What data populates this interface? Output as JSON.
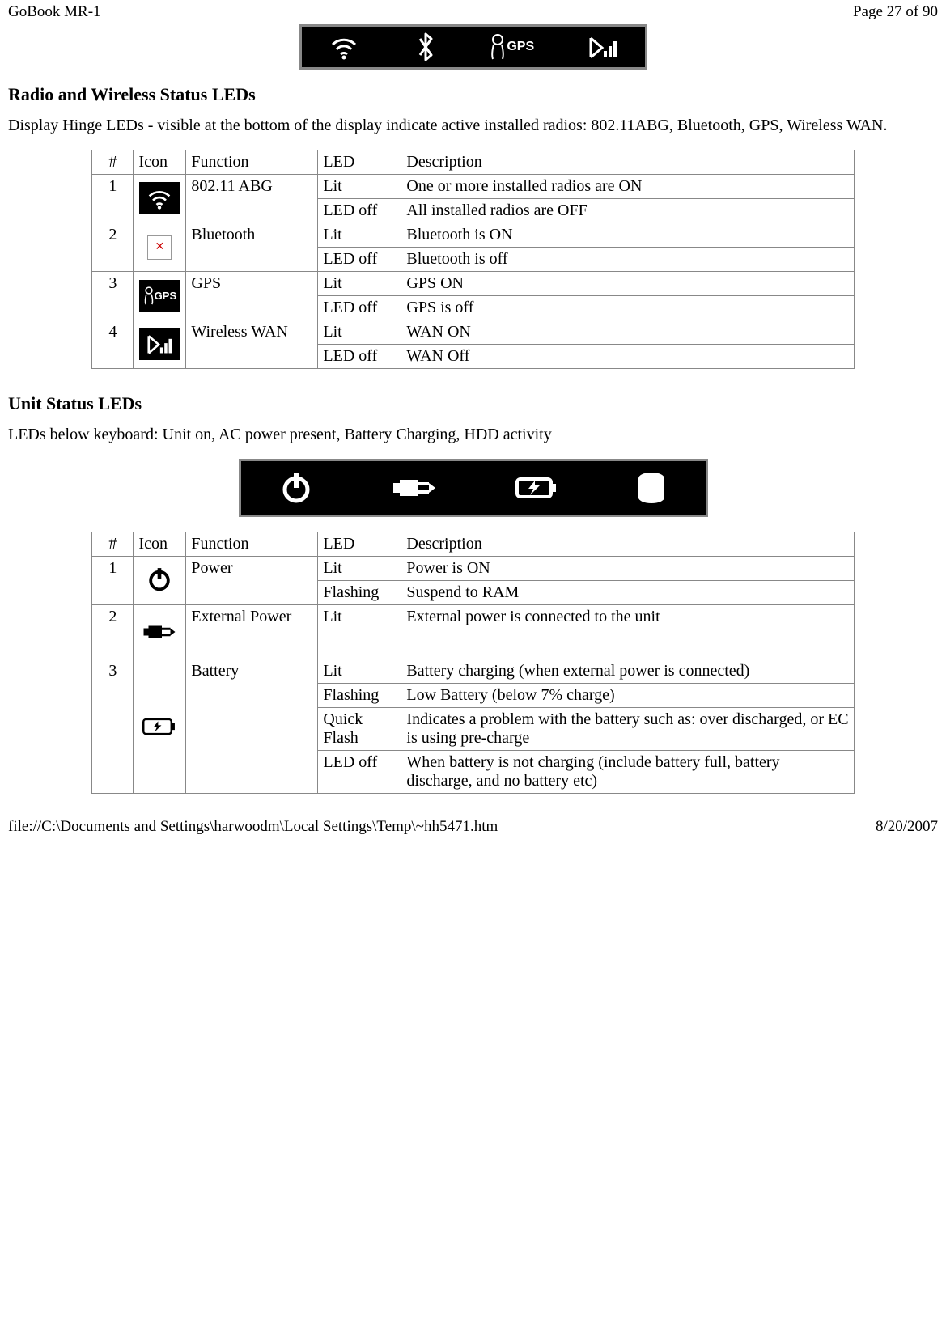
{
  "header": {
    "left": "GoBook MR-1",
    "right": "Page 27 of 90"
  },
  "footer": {
    "left": "file://C:\\Documents and Settings\\harwoodm\\Local Settings\\Temp\\~hh5471.htm",
    "right": "8/20/2007"
  },
  "section1": {
    "heading": "Radio and Wireless Status LEDs",
    "text": "Display Hinge LEDs - visible at the bottom of the display indicate active installed radios:  802.11ABG, Bluetooth, GPS, Wireless WAN."
  },
  "table1": {
    "headers": {
      "num": "#",
      "icon": "Icon",
      "func": "Function",
      "led": "LED",
      "desc": "Description"
    },
    "rows": [
      {
        "num": "1",
        "icon": "wifi",
        "func": "802.11 ABG",
        "states": [
          {
            "led": "Lit",
            "desc": "One or more installed radios are ON"
          },
          {
            "led": "LED off",
            "desc": "All installed radios are OFF"
          }
        ]
      },
      {
        "num": "2",
        "icon": "broken",
        "func": "Bluetooth",
        "states": [
          {
            "led": "Lit",
            "desc": "Bluetooth is ON"
          },
          {
            "led": "LED off",
            "desc": "Bluetooth is off"
          }
        ]
      },
      {
        "num": "3",
        "icon": "gps",
        "func": "GPS",
        "states": [
          {
            "led": "Lit",
            "desc": "GPS ON"
          },
          {
            "led": "LED off",
            "desc": "GPS is off"
          }
        ]
      },
      {
        "num": "4",
        "icon": "signal",
        "func": "Wireless WAN",
        "states": [
          {
            "led": "Lit",
            "desc": "WAN ON"
          },
          {
            "led": "LED off",
            "desc": "WAN Off"
          }
        ]
      }
    ]
  },
  "section2": {
    "heading": "Unit Status LEDs",
    "text": "LEDs below keyboard:  Unit on, AC power present, Battery Charging, HDD activity"
  },
  "table2": {
    "headers": {
      "num": "#",
      "icon": "Icon",
      "func": "Function",
      "led": "LED",
      "desc": "Description"
    },
    "rows": [
      {
        "num": "1",
        "icon": "power",
        "func": "Power",
        "states": [
          {
            "led": "Lit",
            "desc": "Power is ON"
          },
          {
            "led": "Flashing",
            "desc": "Suspend to RAM"
          }
        ]
      },
      {
        "num": "2",
        "icon": "plug",
        "func": "External Power",
        "states": [
          {
            "led": "Lit",
            "desc": "External power is connected to the unit"
          }
        ]
      },
      {
        "num": "3",
        "icon": "battery",
        "func": "Battery",
        "states": [
          {
            "led": "Lit",
            "desc": "Battery charging (when external power is connected)"
          },
          {
            "led": "Flashing",
            "desc": "Low Battery (below 7% charge)"
          },
          {
            "led": "Quick Flash",
            "desc": "Indicates a problem with the battery such as: over discharged, or EC is using pre-charge"
          },
          {
            "led": "LED off",
            "desc": "When battery is not charging  (include battery full, battery discharge, and no battery etc)"
          }
        ]
      }
    ]
  }
}
